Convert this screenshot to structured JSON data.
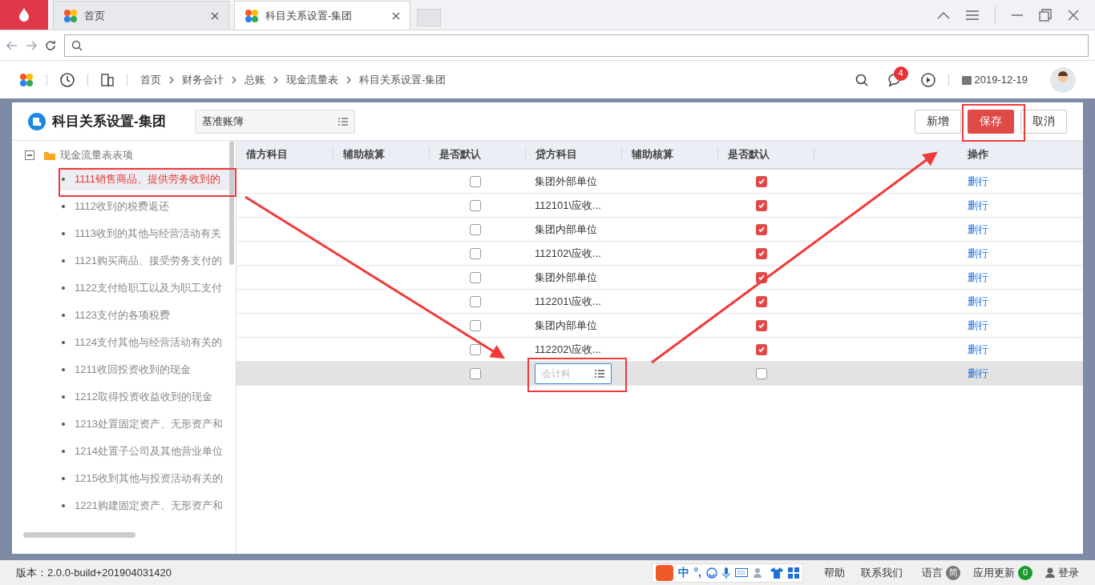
{
  "browser": {
    "tabs": [
      {
        "label": "首页",
        "selected": false
      },
      {
        "label": "科目关系设置-集团",
        "selected": true
      }
    ]
  },
  "header": {
    "breadcrumb": [
      "首页",
      "财务会计",
      "总账",
      "现金流量表",
      "科目关系设置-集团"
    ],
    "message_count": "4",
    "date": "2019-12-19"
  },
  "page": {
    "title": "科目关系设置-集团",
    "ledger_select": "基准账簿",
    "buttons": [
      {
        "label": "新增",
        "kind": "default"
      },
      {
        "label": "保存",
        "kind": "primary"
      },
      {
        "label": "取消",
        "kind": "default"
      }
    ]
  },
  "tree": {
    "root": {
      "label": "现金流量表表项",
      "expanded": true,
      "children": [
        {
          "label": "1111销售商品、提供劳务收到的",
          "selected": true
        },
        {
          "label": "1112收到的税费返还",
          "selected": false
        },
        {
          "label": "1113收到的其他与经营活动有关",
          "selected": false
        },
        {
          "label": "1121购买商品、接受劳务支付的",
          "selected": false
        },
        {
          "label": "1122支付给职工以及为职工支付",
          "selected": false
        },
        {
          "label": "1123支付的各项税费",
          "selected": false
        },
        {
          "label": "1124支付其他与经营活动有关的",
          "selected": false
        },
        {
          "label": "1211收回投资收到的现金",
          "selected": false
        },
        {
          "label": "1212取得投资收益收到的现金",
          "selected": false
        },
        {
          "label": "1213处置固定资产、无形资产和",
          "selected": false
        },
        {
          "label": "1214处置子公司及其他营业单位",
          "selected": false
        },
        {
          "label": "1215收到其他与投资活动有关的",
          "selected": false
        },
        {
          "label": "1221购建固定资产、无形资产和",
          "selected": false
        }
      ]
    }
  },
  "table": {
    "columns": [
      "借方科目",
      "辅助核算",
      "是否默认",
      "贷方科目",
      "辅助核算",
      "是否默认",
      "操作"
    ],
    "rows": [
      {
        "kind": "text",
        "debit_default": false,
        "credit_subject": "集团外部单位",
        "credit_default": true,
        "action": "删行",
        "selected": false
      },
      {
        "kind": "text",
        "debit_default": false,
        "credit_subject": "112101\\应收...",
        "credit_default": true,
        "action": "删行",
        "selected": false
      },
      {
        "kind": "text",
        "debit_default": false,
        "credit_subject": "集团内部单位",
        "credit_default": true,
        "action": "删行",
        "selected": false
      },
      {
        "kind": "text",
        "debit_default": false,
        "credit_subject": "112102\\应收...",
        "credit_default": true,
        "action": "删行",
        "selected": false
      },
      {
        "kind": "text",
        "debit_default": false,
        "credit_subject": "集团外部单位",
        "credit_default": true,
        "action": "删行",
        "selected": false
      },
      {
        "kind": "text",
        "debit_default": false,
        "credit_subject": "112201\\应收...",
        "credit_default": true,
        "action": "删行",
        "selected": false
      },
      {
        "kind": "text",
        "debit_default": false,
        "credit_subject": "集团内部单位",
        "credit_default": true,
        "action": "删行",
        "selected": false
      },
      {
        "kind": "text",
        "debit_default": false,
        "credit_subject": "112202\\应收...",
        "credit_default": true,
        "action": "删行",
        "selected": false
      },
      {
        "kind": "input",
        "debit_default": false,
        "placeholder": "会计科",
        "credit_default": false,
        "action": "删行",
        "selected": true
      }
    ]
  },
  "status_bar": {
    "version": "版本：2.0.0-build+201904031420",
    "ime": [
      "中",
      "°,"
    ],
    "links": [
      "帮助",
      "联系我们"
    ],
    "language": {
      "label": "语言",
      "badge": "简"
    },
    "update": {
      "label": "应用更新",
      "badge": "0"
    },
    "login": "登录"
  }
}
